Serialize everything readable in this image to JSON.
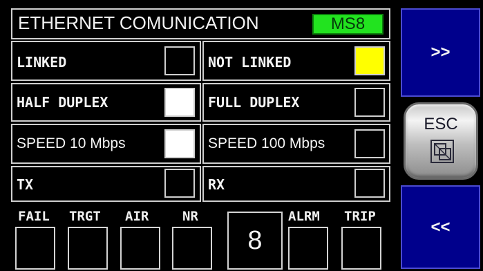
{
  "header": {
    "title": "ETHERNET COMUNICATION",
    "module": "MS8",
    "module_color": "#22e31f"
  },
  "status": {
    "linked": {
      "label": "LINKED",
      "state": "off"
    },
    "not_linked": {
      "label": "NOT LINKED",
      "state": "on",
      "color": "#ffff00"
    },
    "half_duplex": {
      "label": "HALF DUPLEX",
      "state": "on",
      "color": "#ffffff"
    },
    "full_duplex": {
      "label": "FULL DUPLEX",
      "state": "off"
    },
    "speed_10": {
      "label": "SPEED 10 Mbps",
      "state": "on",
      "color": "#ffffff"
    },
    "speed_100": {
      "label": "SPEED 100 Mbps",
      "state": "off"
    },
    "tx": {
      "label": "TX",
      "state": "off"
    },
    "rx": {
      "label": "RX",
      "state": "off"
    }
  },
  "bottom": {
    "fail": "FAIL",
    "trgt": "TRGT",
    "air": "AIR",
    "nr": "NR",
    "counter": "8",
    "alrm": "ALRM",
    "trip": "TRIP"
  },
  "nav": {
    "next_label": ">>",
    "esc_label": "ESC",
    "esc_icon": "window-restore-icon",
    "prev_label": "<<",
    "button_color": "#00008c"
  }
}
